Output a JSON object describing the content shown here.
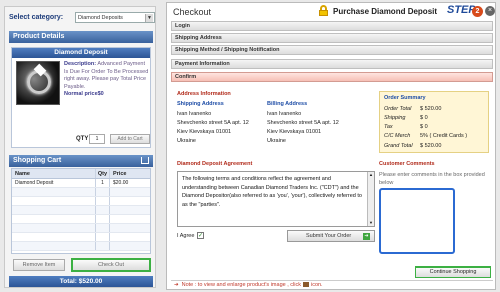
{
  "left": {
    "category_label": "Select category:",
    "category_value": "Diamond Deposits",
    "product_details_header": "Product Details",
    "product": {
      "name": "Diamond Deposit",
      "description_label": "Description:",
      "description_text": "Advanced Payment Is Due For Order To Be Processed right away. Please pay Total Price Payable.",
      "normal_price": "Normal price$0"
    },
    "qty_label": "QTY",
    "qty_value": "1",
    "add_to_cart": "Add to Cart",
    "cart_header": "Shopping Cart",
    "cart_columns": [
      "Name",
      "Qty",
      "Price"
    ],
    "cart_rows": [
      {
        "name": "Diamond Deposit",
        "qty": "1",
        "price": "$20.00"
      }
    ],
    "remove_item": "Remove Item",
    "check_out": "Check Out",
    "total": "Total: $520.00"
  },
  "right": {
    "title": "Checkout",
    "heading": "Purchase Diamond Deposit",
    "step_label": "STEP",
    "step_number": "2",
    "close": "×",
    "sections": [
      "Login",
      "Shipping Address",
      "Shipping Method / Shipping Notification",
      "Payment Information",
      "Confirm"
    ],
    "address_info": "Address Information",
    "shipping_address_label": "Shipping Address",
    "billing_address_label": "Billing Address",
    "shipping_lines": [
      "Ivan Ivanenko",
      "Shevchenko street 5A apt. 12",
      "Kiev Kievskaya 01001",
      "Ukraine"
    ],
    "billing_lines": [
      "Ivan Ivanenko",
      "Shevchenko street 5A apt. 12",
      "Kiev Kievskaya 01001",
      "Ukraine"
    ],
    "agreement_label": "Diamond Deposit Agreement",
    "agreement_text": "The following terms and conditions reflect the agreement and understanding between Canadian Diamond Traders Inc. (\"CDT\") and the Diamond Depositor(also referred to as 'you', 'your'), collectively referred to as the \"parties\".",
    "i_agree": "I Agree",
    "submit_order": "Submit Your Order",
    "order_summary": {
      "title": "Order Summary",
      "rows": [
        {
          "k": "Order Total",
          "v": "$ 520.00"
        },
        {
          "k": "Shipping",
          "v": "$ 0"
        },
        {
          "k": "Tax",
          "v": "$ 0"
        },
        {
          "k": "C/C Merch",
          "v": "5% ( Credit Cards )"
        },
        {
          "k": "Grand Total",
          "v": "$ 520.00"
        }
      ]
    },
    "customer_comments": "Customer Comments",
    "comments_prompt": "Please enter comments in the box provided below",
    "continue_shopping": "Continue Shopping",
    "note_prefix": "Note : to view and enlarge  product's image , click",
    "note_suffix": "icon."
  }
}
